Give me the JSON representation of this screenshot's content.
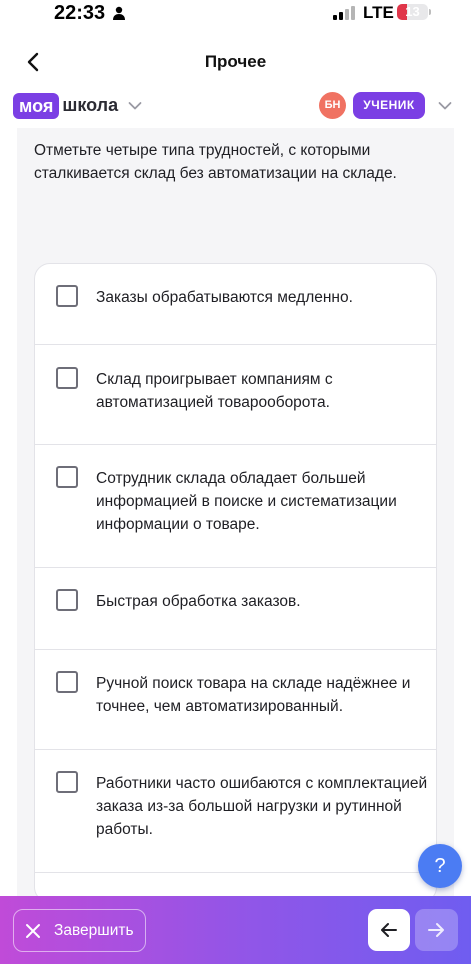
{
  "status_bar": {
    "time": "22:33",
    "network": "LTE",
    "battery": "13"
  },
  "nav": {
    "title": "Прочее"
  },
  "brand": {
    "part1": "моя",
    "part2": "школа"
  },
  "user": {
    "initials": "БН",
    "role": "УЧЕНИК"
  },
  "question": "Отметьте четыре типа трудностей, с которыми сталкивается склад без автоматизации на складе.",
  "options": [
    {
      "text": "Заказы обрабатываются медленно.",
      "checked": false
    },
    {
      "text": "Склад проигрывает компаниям с автоматизацией товарооборота.",
      "checked": false
    },
    {
      "text": "Сотрудник склада обладает большей информацией в поиске и систематизации информации о товаре.",
      "checked": false
    },
    {
      "text": "Быстрая обработка заказов.",
      "checked": false
    },
    {
      "text": "Ручной поиск товара на складе надёжнее и точнее, чем автоматизированный.",
      "checked": false
    },
    {
      "text": "Работники часто ошибаются с комплектацией заказа из-за большой нагрузки и рутинной работы.",
      "checked": false
    }
  ],
  "help": {
    "label": "?"
  },
  "bottom": {
    "finish_label": "Завершить"
  },
  "colors": {
    "accent": "#7b3fe4",
    "help": "#4b7cf3",
    "avatar": "#f07262"
  },
  "icons": [
    "person-icon",
    "signal-icon",
    "back-icon",
    "chevron-down-icon",
    "close-icon",
    "arrow-left-icon",
    "arrow-right-icon"
  ]
}
